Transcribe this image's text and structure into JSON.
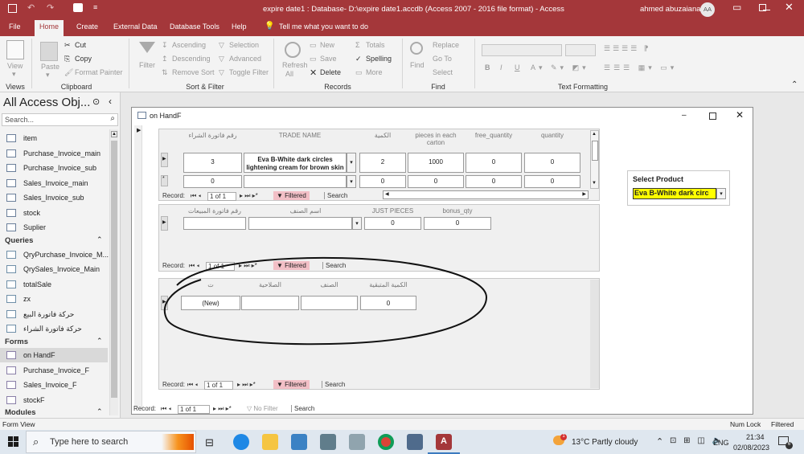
{
  "window": {
    "title": "expire date1 : Database- D:\\expire date1.accdb (Access 2007 - 2016 file format)  -  Access",
    "user": "ahmed abuzaiana",
    "user_initials": "AA"
  },
  "tabs": [
    "File",
    "Home",
    "Create",
    "External Data",
    "Database Tools",
    "Help"
  ],
  "tell_me": "Tell me what you want to do",
  "ribbon": {
    "views": {
      "view": "View",
      "group": "Views"
    },
    "clipboard": {
      "paste": "Paste",
      "cut": "Cut",
      "copy": "Copy",
      "format_painter": "Format Painter",
      "group": "Clipboard"
    },
    "sort_filter": {
      "filter": "Filter",
      "ascending": "Ascending",
      "descending": "Descending",
      "remove_sort": "Remove Sort",
      "selection": "Selection",
      "advanced": "Advanced",
      "toggle_filter": "Toggle Filter",
      "group": "Sort & Filter"
    },
    "records": {
      "refresh": "Refresh",
      "refresh_all": "All",
      "new": "New",
      "save": "Save",
      "delete": "Delete",
      "totals": "Totals",
      "spelling": "Spelling",
      "more": "More",
      "group": "Records"
    },
    "find": {
      "find": "Find",
      "replace": "Replace",
      "goto": "Go To",
      "select": "Select",
      "group": "Find"
    },
    "text_formatting": {
      "group": "Text Formatting",
      "bold": "B",
      "italic": "I",
      "underline": "U"
    }
  },
  "nav": {
    "title": "All Access Obj...",
    "search_placeholder": "Search...",
    "tables": [
      "item",
      "Purchase_Invoice_main",
      "Purchase_Invoice_sub",
      "Sales_Invoice_main",
      "Sales_Invoice_sub",
      "stock",
      "Suplier"
    ],
    "queries_header": "Queries",
    "queries": [
      "QryPurchase_Invoice_M...",
      "QrySales_Invoice_Main",
      "totalSale",
      "zx",
      "حركة فاتورة البيع",
      "حركة فاتورة الشراء"
    ],
    "forms_header": "Forms",
    "forms": [
      "on HandF",
      "Purchase_Invoice_F",
      "Sales_Invoice_F",
      "stockF"
    ],
    "modules_header": "Modules"
  },
  "form": {
    "title": "on HandF",
    "sub1": {
      "headers": [
        "رقم فاتورة الشراء",
        "TRADE NAME",
        "الكمية",
        "pieces in each carton",
        "free_quantity",
        "quantity"
      ],
      "row1": [
        "3",
        "Eva B-White dark circles lightening cream for brown skin",
        "2",
        "1000",
        "0",
        "0"
      ],
      "row2": [
        "0",
        "",
        "0",
        "0",
        "0",
        "0"
      ],
      "record": "Record:",
      "pos": "1 of 1",
      "filtered": "Filtered",
      "search": "Search"
    },
    "sub2": {
      "headers": [
        "رقم فاتورة المبيعات",
        "اسم الصنف",
        "JUST PIECES",
        "bonus_qty"
      ],
      "row1": [
        "",
        "",
        "0",
        "0"
      ],
      "record": "Record:",
      "pos": "1 of 1",
      "filtered": "Filtered",
      "search": "Search"
    },
    "sub3": {
      "headers": [
        "ت",
        "الصلاحية",
        "الصنف",
        "الكمية المتبقية"
      ],
      "row1": [
        "(New)",
        "",
        "",
        "0"
      ],
      "record": "Record:",
      "pos": "1 of 1",
      "filtered": "Filtered",
      "search": "Search"
    },
    "select_product": {
      "label": "Select Product",
      "value": "Eva B-White dark circ"
    },
    "main_record": {
      "record": "Record:",
      "pos": "1 of 1",
      "no_filter": "No Filter",
      "search": "Search"
    }
  },
  "status": {
    "left": "Form View",
    "num_lock": "Num Lock",
    "filtered": "Filtered"
  },
  "taskbar": {
    "search": "Type here to search",
    "temp": "13°C  Partly cloudy",
    "lang": "ENG",
    "time": "21:34",
    "date": "02/08/2023",
    "weather_badge": "1",
    "notif_count": "6"
  },
  "colors": {
    "accent": "#a4373a",
    "highlight": "#ffff00",
    "filtered": "#f2bfc6"
  }
}
